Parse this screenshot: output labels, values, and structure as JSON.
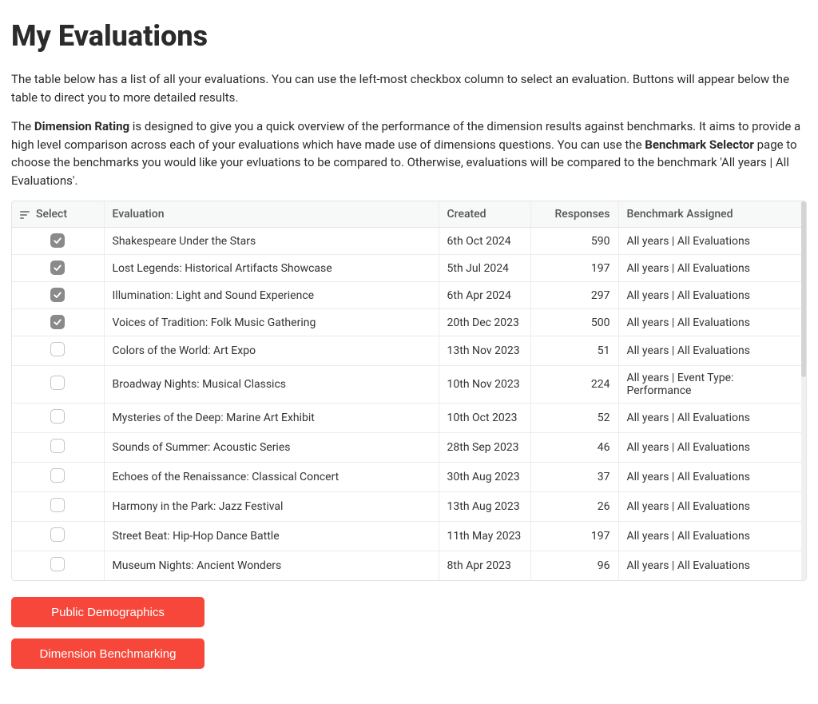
{
  "page": {
    "title": "My Evaluations",
    "intro1": "The table below has a list of all your evaluations. You can use the left-most checkbox column to select an evaluation. Buttons will appear below the table to direct you to more detailed results.",
    "intro2_lead": "The ",
    "intro2_bold1": "Dimension Rating",
    "intro2_mid": " is designed to give you a quick overview of the performance of the dimension results against benchmarks. It aims to provide a high level comparison across each of your evaluations which have made use of dimensions questions. You can use the ",
    "intro2_bold2": "Benchmark Selector",
    "intro2_tail": " page to choose the benchmarks you would like your evluations to be compared to. Otherwise, evaluations will be compared to the benchmark 'All years | All Evaluations'."
  },
  "table": {
    "headers": {
      "select": "Select",
      "evaluation": "Evaluation",
      "created": "Created",
      "responses": "Responses",
      "benchmark": "Benchmark Assigned"
    },
    "rows": [
      {
        "selected": true,
        "evaluation": "Shakespeare Under the Stars",
        "created": "6th Oct 2024",
        "responses": "590",
        "benchmark": "All years | All Evaluations"
      },
      {
        "selected": true,
        "evaluation": "Lost Legends: Historical Artifacts Showcase",
        "created": "5th Jul 2024",
        "responses": "197",
        "benchmark": "All years | All Evaluations"
      },
      {
        "selected": true,
        "evaluation": "Illumination: Light and Sound Experience",
        "created": "6th Apr 2024",
        "responses": "297",
        "benchmark": "All years | All Evaluations"
      },
      {
        "selected": true,
        "evaluation": "Voices of Tradition: Folk Music Gathering",
        "created": "20th Dec 2023",
        "responses": "500",
        "benchmark": "All years | All Evaluations"
      },
      {
        "selected": false,
        "evaluation": "Colors of the World: Art Expo",
        "created": "13th Nov 2023",
        "responses": "51",
        "benchmark": "All years | All Evaluations"
      },
      {
        "selected": false,
        "evaluation": "Broadway Nights: Musical Classics",
        "created": "10th Nov 2023",
        "responses": "224",
        "benchmark": "All years | Event Type: Performance"
      },
      {
        "selected": false,
        "evaluation": "Mysteries of the Deep: Marine Art Exhibit",
        "created": "10th Oct 2023",
        "responses": "52",
        "benchmark": "All years | All Evaluations"
      },
      {
        "selected": false,
        "evaluation": "Sounds of Summer: Acoustic Series",
        "created": "28th Sep 2023",
        "responses": "46",
        "benchmark": "All years | All Evaluations"
      },
      {
        "selected": false,
        "evaluation": "Echoes of the Renaissance: Classical Concert",
        "created": "30th Aug 2023",
        "responses": "37",
        "benchmark": "All years | All Evaluations"
      },
      {
        "selected": false,
        "evaluation": "Harmony in the Park: Jazz Festival",
        "created": "13th Aug 2023",
        "responses": "26",
        "benchmark": "All years | All Evaluations"
      },
      {
        "selected": false,
        "evaluation": "Street Beat: Hip-Hop Dance Battle",
        "created": "11th May 2023",
        "responses": "197",
        "benchmark": "All years | All Evaluations"
      },
      {
        "selected": false,
        "evaluation": "Museum Nights: Ancient Wonders",
        "created": "8th Apr 2023",
        "responses": "96",
        "benchmark": "All years | All Evaluations"
      }
    ]
  },
  "actions": {
    "public_demographics": "Public Demographics",
    "dimension_benchmarking": "Dimension Benchmarking"
  }
}
